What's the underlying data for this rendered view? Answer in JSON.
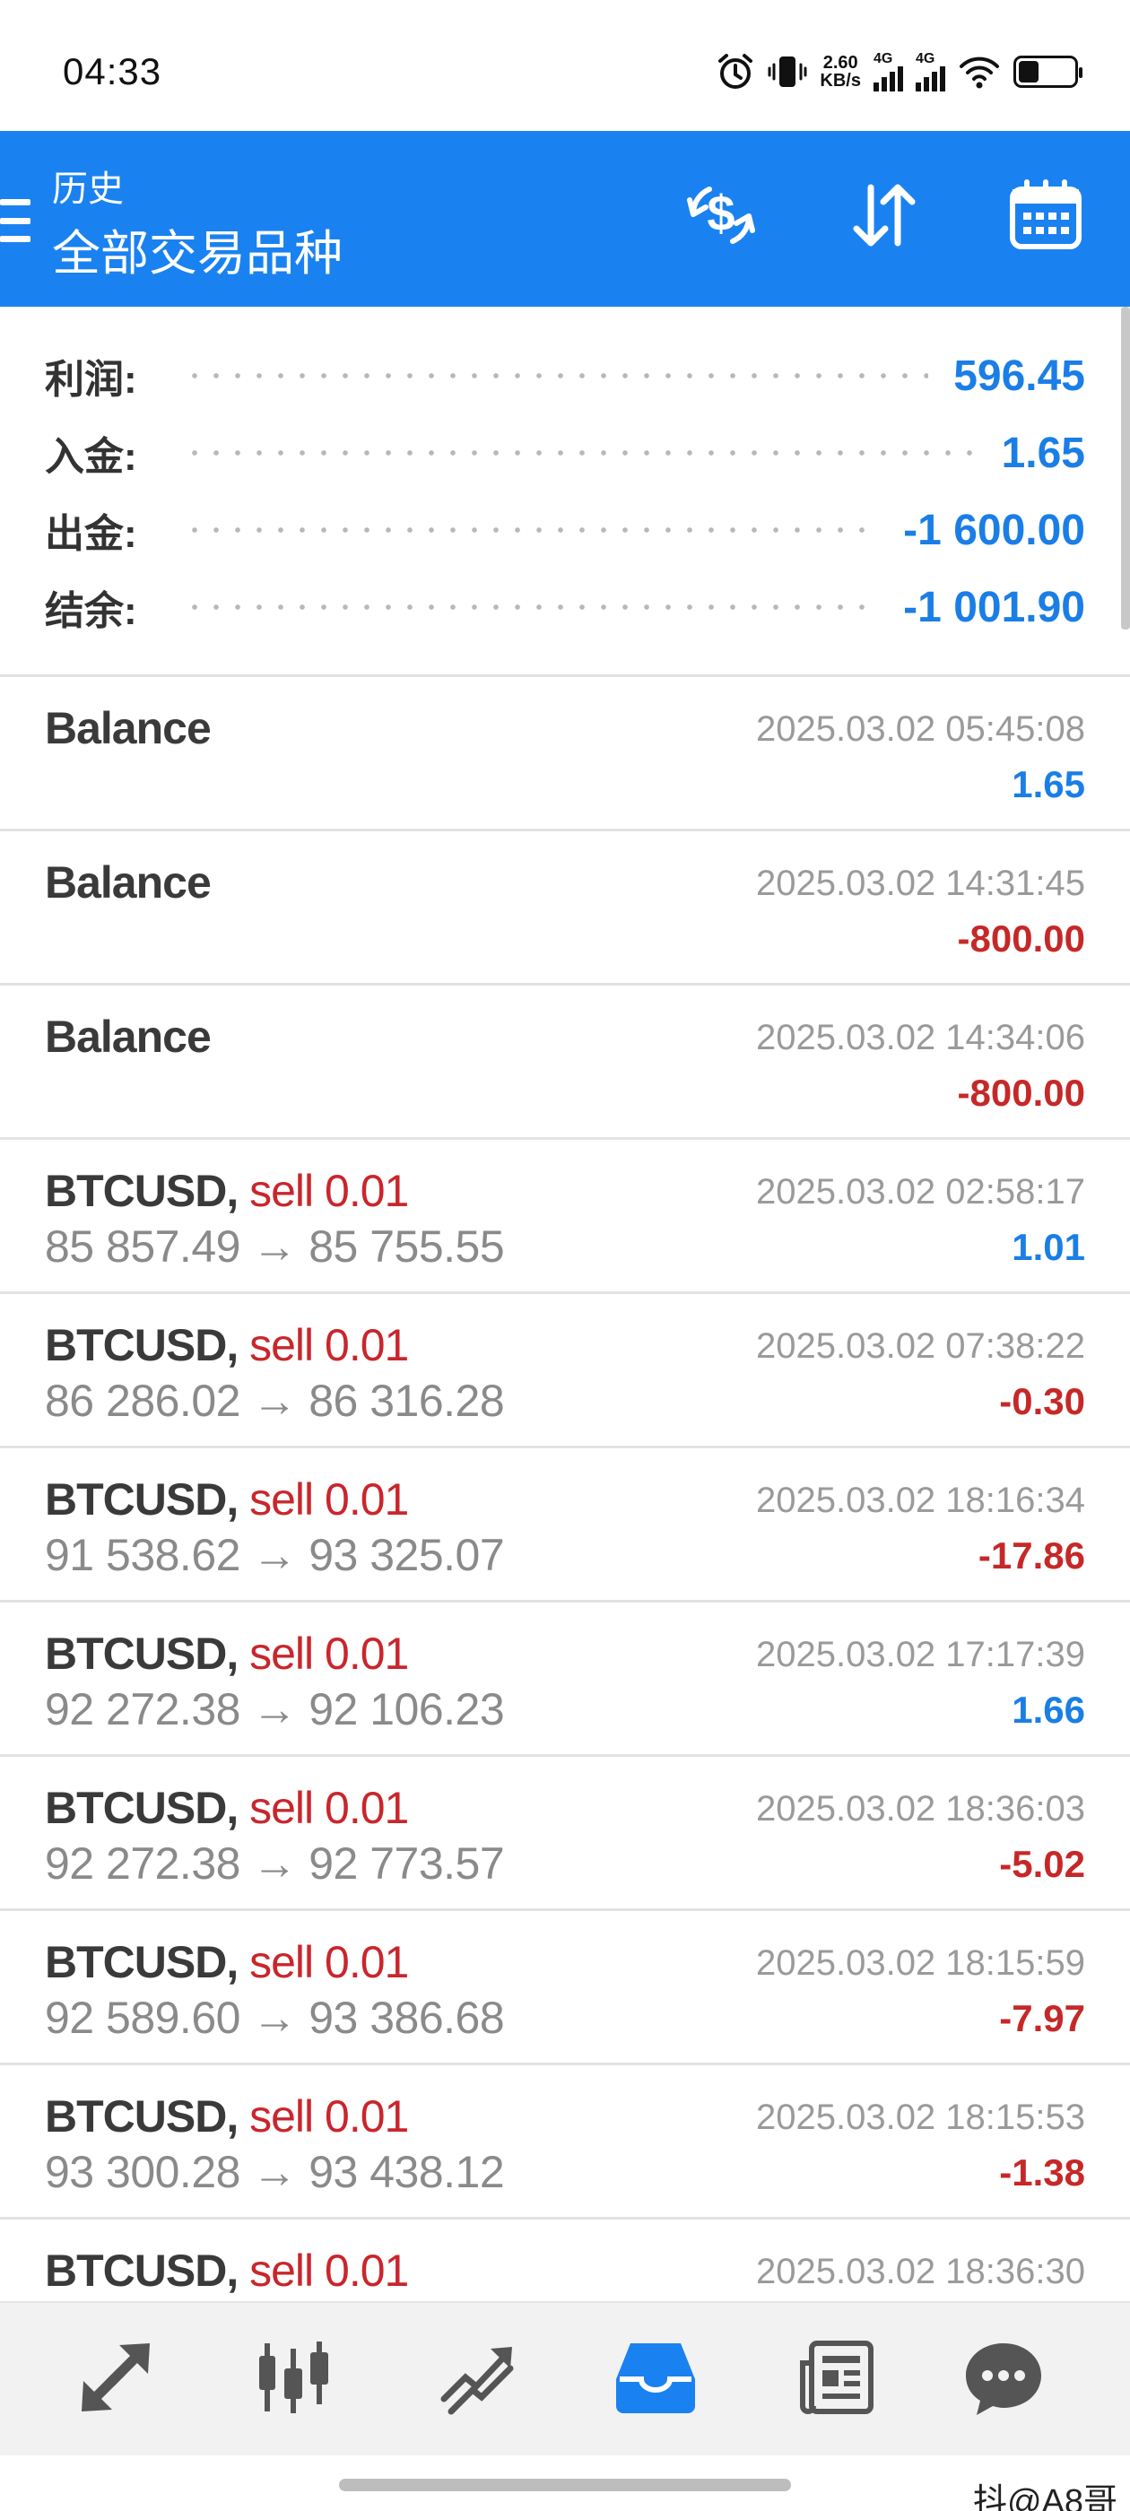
{
  "status_bar": {
    "time": "04:33",
    "net_speed_value": "2.60",
    "net_speed_unit": "KB/s",
    "sim1_tag": "4G",
    "sim2_tag": "4G"
  },
  "app_bar": {
    "title": "历史",
    "subtitle": "全部交易品种",
    "accent_color": "#1a82f0",
    "actions": [
      "currency-exchange-icon",
      "sort-icon",
      "calendar-icon"
    ]
  },
  "summary": {
    "profit_label": "利润:",
    "profit_value": "596.45",
    "deposit_label": "入金:",
    "deposit_value": "1.65",
    "withdrawal_label": "出金:",
    "withdrawal_value": "-1 600.00",
    "balance_label": "结余:",
    "balance_value": "-1 001.90"
  },
  "deals": [
    {
      "type": "balance",
      "symbol": "Balance",
      "time": "2025.03.02 05:45:08",
      "profit": "1.65",
      "sign": "pos"
    },
    {
      "type": "balance",
      "symbol": "Balance",
      "time": "2025.03.02 14:31:45",
      "profit": "-800.00",
      "sign": "neg"
    },
    {
      "type": "balance",
      "symbol": "Balance",
      "time": "2025.03.02 14:34:06",
      "profit": "-800.00",
      "sign": "neg"
    },
    {
      "type": "trade",
      "symbol": "BTCUSD",
      "side": "sell 0.01",
      "prices": "85 857.49 → 85 755.55",
      "time": "2025.03.02 02:58:17",
      "profit": "1.01",
      "sign": "pos"
    },
    {
      "type": "trade",
      "symbol": "BTCUSD",
      "side": "sell 0.01",
      "prices": "86 286.02 → 86 316.28",
      "time": "2025.03.02 07:38:22",
      "profit": "-0.30",
      "sign": "neg"
    },
    {
      "type": "trade",
      "symbol": "BTCUSD",
      "side": "sell 0.01",
      "prices": "91 538.62 → 93 325.07",
      "time": "2025.03.02 18:16:34",
      "profit": "-17.86",
      "sign": "neg"
    },
    {
      "type": "trade",
      "symbol": "BTCUSD",
      "side": "sell 0.01",
      "prices": "92 272.38 → 92 106.23",
      "time": "2025.03.02 17:17:39",
      "profit": "1.66",
      "sign": "pos"
    },
    {
      "type": "trade",
      "symbol": "BTCUSD",
      "side": "sell 0.01",
      "prices": "92 272.38 → 92 773.57",
      "time": "2025.03.02 18:36:03",
      "profit": "-5.02",
      "sign": "neg"
    },
    {
      "type": "trade",
      "symbol": "BTCUSD",
      "side": "sell 0.01",
      "prices": "92 589.60 → 93 386.68",
      "time": "2025.03.02 18:15:59",
      "profit": "-7.97",
      "sign": "neg"
    },
    {
      "type": "trade",
      "symbol": "BTCUSD",
      "side": "sell 0.01",
      "prices": "93 300.28 → 93 438.12",
      "time": "2025.03.02 18:15:53",
      "profit": "-1.38",
      "sign": "neg"
    },
    {
      "type": "trade",
      "symbol": "BTCUSD",
      "side": "sell 0.01",
      "prices": "",
      "time": "2025.03.02 18:36:30",
      "profit": "",
      "sign": "neg"
    }
  ],
  "bottom_nav": {
    "items": [
      "quotes-icon",
      "chart-icon",
      "trade-icon",
      "history-icon",
      "news-icon",
      "chat-icon"
    ],
    "active": "history-icon",
    "active_color": "#1a82f0",
    "inactive_color": "#555555"
  },
  "watermark": "抖@A8哥"
}
